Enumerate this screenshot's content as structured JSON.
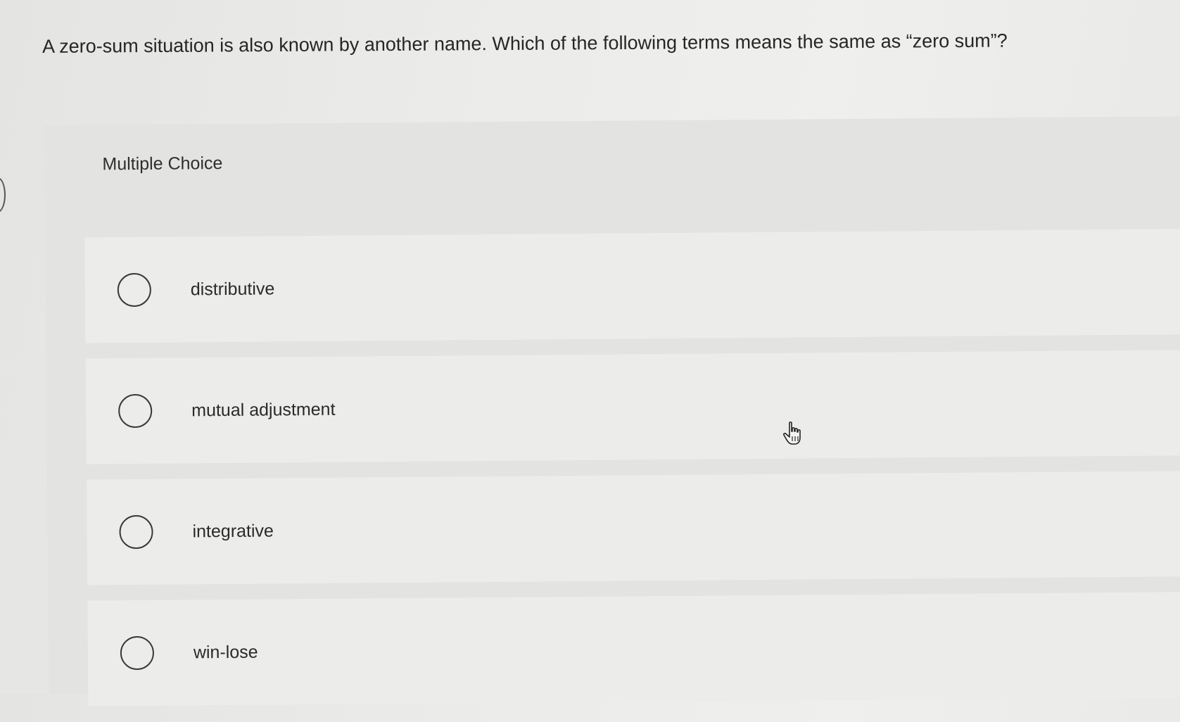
{
  "question": {
    "text": "A zero-sum situation is also known by another name. Which of the following terms means the same as “zero sum”?"
  },
  "multiple_choice": {
    "label": "Multiple Choice",
    "options": [
      {
        "label": "distributive",
        "selected": false
      },
      {
        "label": "mutual adjustment",
        "selected": false
      },
      {
        "label": "integrative",
        "selected": false
      },
      {
        "label": "win-lose",
        "selected": false
      }
    ]
  },
  "cursor": {
    "icon": "hand-pointer-icon"
  }
}
